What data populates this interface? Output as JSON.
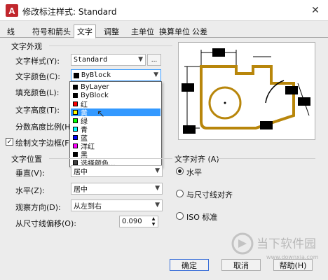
{
  "window": {
    "title": "修改标注样式: Standard",
    "close_glyph": "✕",
    "logo_letter": "A"
  },
  "tabs": [
    {
      "label": "线",
      "active": false
    },
    {
      "label": "符号和箭头",
      "active": false
    },
    {
      "label": "文字",
      "active": true
    },
    {
      "label": "调整",
      "active": false
    },
    {
      "label": "主单位",
      "active": false
    },
    {
      "label": "换算单位",
      "active": false
    },
    {
      "label": "公差",
      "active": false
    }
  ],
  "appearance": {
    "group_title": "文字外观",
    "text_style_label": "文字样式(Y):",
    "text_style_value": "Standard",
    "text_style_button": "...",
    "text_color_label": "文字颜色(C):",
    "text_color_value": "ByBlock",
    "fill_color_label": "填充颜色(L):",
    "text_height_label": "文字高度(T):",
    "fraction_scale_label": "分数高度比例(H):",
    "frame_checkbox_label": "绘制文字边框(F)",
    "frame_checked": true
  },
  "color_dropdown": {
    "items": [
      {
        "label": "ByLayer",
        "color": "#000000"
      },
      {
        "label": "ByBlock",
        "color": "#000000"
      },
      {
        "label": "红",
        "color": "#ff0000"
      },
      {
        "label": "黄",
        "color": "#ffff00",
        "highlighted": true
      },
      {
        "label": "绿",
        "color": "#00ff00"
      },
      {
        "label": "青",
        "color": "#00ffff"
      },
      {
        "label": "蓝",
        "color": "#0000ff"
      },
      {
        "label": "洋红",
        "color": "#ff00ff"
      },
      {
        "label": "黑",
        "color": "#000000"
      },
      {
        "label": "选择颜色...",
        "color": "#404040"
      }
    ]
  },
  "placement": {
    "group_title": "文字位置",
    "vertical_label": "垂直(V):",
    "vertical_value": "居中",
    "horizontal_label": "水平(Z):",
    "horizontal_value": "居中",
    "view_direction_label": "观察方向(D):",
    "view_direction_value": "从左到右",
    "offset_label": "从尺寸线偏移(O):",
    "offset_value": "0.090"
  },
  "alignment": {
    "group_title": "文字对齐 (A)",
    "options": [
      {
        "label": "水平",
        "selected": true
      },
      {
        "label": "与尺寸线对齐",
        "selected": false
      },
      {
        "label": "ISO 标准",
        "selected": false
      }
    ]
  },
  "buttons": {
    "ok": "确定",
    "cancel": "取消",
    "help": "帮助(H)"
  },
  "watermark": {
    "brand": "当下软件园",
    "url": "www.downxia.com"
  },
  "colors": {
    "accent": "#3399ff",
    "preview_outline": "#b8860b"
  }
}
